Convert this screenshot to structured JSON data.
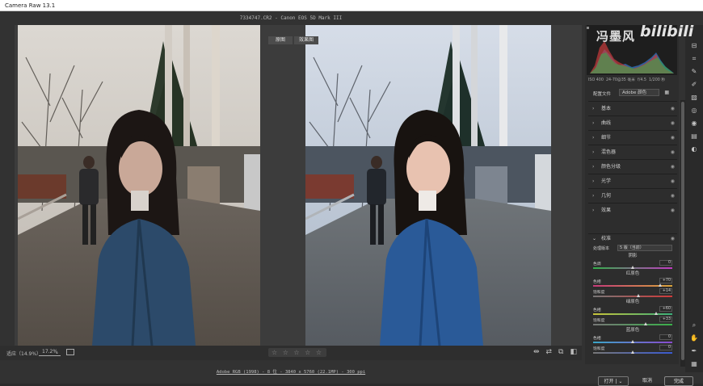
{
  "window": {
    "title": "Camera Raw 13.1"
  },
  "file_info": "7334747.CR2  -  Canon EOS 5D Mark III",
  "compare_tags": {
    "before": "原图",
    "after": "效果图"
  },
  "camera_info": {
    "iso": "ISO 400",
    "lens": "24-70@35 毫米",
    "aperture": "f/4.5",
    "shutter": "1/200 秒"
  },
  "watermark": {
    "name": "冯墨风",
    "logo": "bilibili"
  },
  "profile": {
    "label": "配置文件",
    "value": "Adobe 颜色",
    "grid_icon": "grid-icon"
  },
  "sections": [
    {
      "label": "基本"
    },
    {
      "label": "曲线"
    },
    {
      "label": "细节"
    },
    {
      "label": "混色器"
    },
    {
      "label": "颜色分级"
    },
    {
      "label": "光学"
    },
    {
      "label": "几何"
    },
    {
      "label": "效果"
    }
  ],
  "calibration": {
    "title": "校准",
    "process_label": "处理版本",
    "process_value": "5 版（当前）",
    "shadow_group": "阴影",
    "red_group": "红原色",
    "green_group": "绿原色",
    "blue_group": "蓝原色",
    "sliders": [
      {
        "label": "色调",
        "value": "0",
        "position": 0.5,
        "colors": [
          "#33b04a",
          "#c23bc2"
        ]
      },
      {
        "label": "色相",
        "value": "+70",
        "position": 0.85,
        "colors": [
          "#c63a7a",
          "#d8a43a"
        ]
      },
      {
        "label": "饱和度",
        "value": "+14",
        "position": 0.57,
        "colors": [
          "#777777",
          "#d03a3a"
        ]
      },
      {
        "label": "色相",
        "value": "+60",
        "position": 0.8,
        "colors": [
          "#c8c43a",
          "#3ab07a"
        ]
      },
      {
        "label": "饱和度",
        "value": "+33",
        "position": 0.66,
        "colors": [
          "#777777",
          "#3ab04a"
        ]
      },
      {
        "label": "色相",
        "value": "0",
        "position": 0.5,
        "colors": [
          "#3aa6c8",
          "#8a4ad0"
        ]
      },
      {
        "label": "饱和度",
        "value": "0",
        "position": 0.5,
        "colors": [
          "#777777",
          "#3a5ad0"
        ]
      }
    ]
  },
  "bottom": {
    "zoom_label": "适应（14.9%）",
    "zoom_value": "17.2%",
    "stars": "☆ ☆ ☆ ☆ ☆",
    "workflow": "Adobe RGB (1998) - 8 位 - 3840 x 5760 (22.1MP) - 300 ppi"
  },
  "buttons": {
    "open": "打开",
    "cancel": "取消",
    "done": "完成"
  },
  "colors": {
    "accent": "#2f6fb8",
    "panel_bg": "#2d2d2d",
    "app_bg": "#323232"
  }
}
